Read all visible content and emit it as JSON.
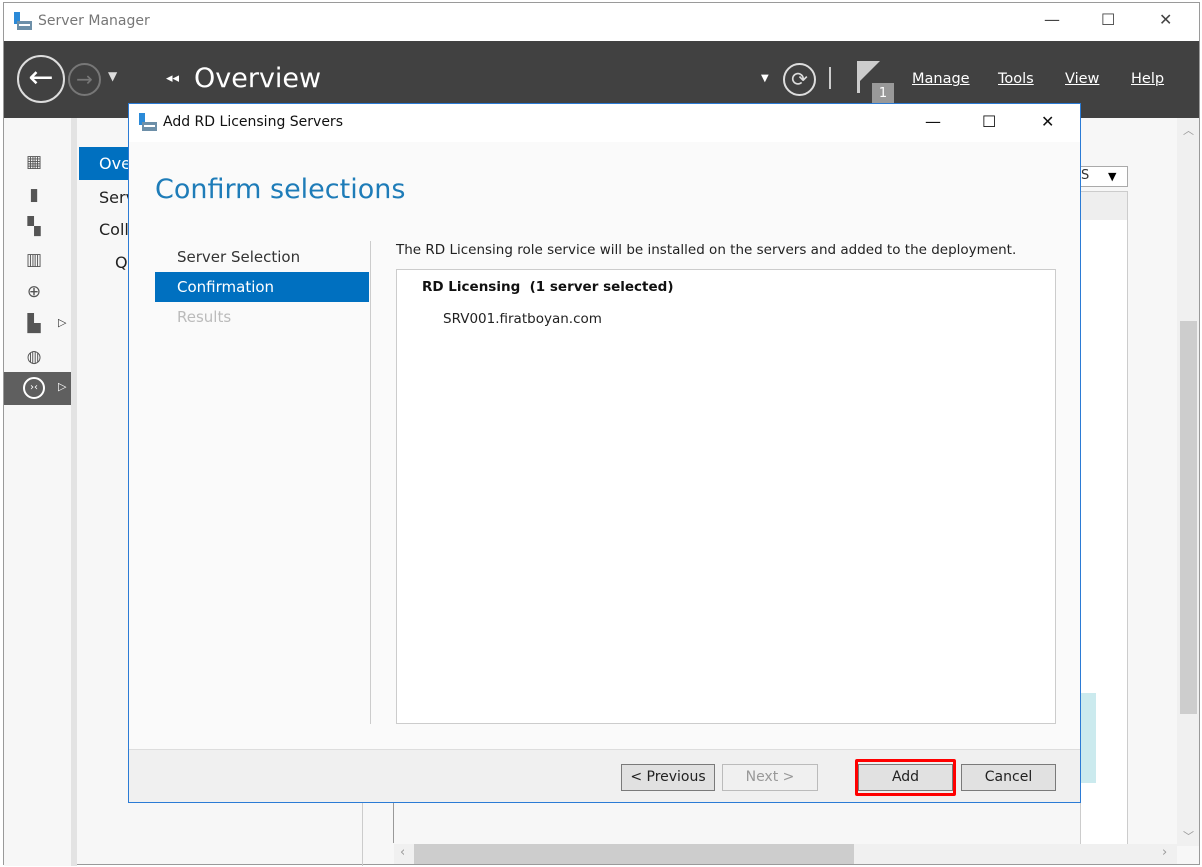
{
  "app": {
    "title": "Server Manager"
  },
  "header": {
    "page_title": "Overview",
    "menus": [
      "Manage",
      "Tools",
      "View",
      "Help"
    ],
    "notification_count": "1"
  },
  "nav_pane": {
    "items": [
      "Ove",
      "Serv",
      "Coll",
      "Q"
    ]
  },
  "background": {
    "dropdown_value": "S"
  },
  "dialog": {
    "title": "Add RD Licensing Servers",
    "heading": "Confirm selections",
    "steps": [
      {
        "label": "Server Selection",
        "state": "done"
      },
      {
        "label": "Confirmation",
        "state": "active"
      },
      {
        "label": "Results",
        "state": "disabled"
      }
    ],
    "description": "The RD Licensing role service will be installed on the servers and added to the deployment.",
    "group_title": "RD Licensing  (1 server selected)",
    "servers": [
      "SRV001.firatboyan.com"
    ],
    "buttons": {
      "previous": "< Previous",
      "next": "Next >",
      "add": "Add",
      "cancel": "Cancel"
    }
  },
  "colors": {
    "accent": "#0070c0",
    "heading": "#1e7cb8",
    "header_bg": "#414141",
    "highlight": "#ff0000"
  }
}
